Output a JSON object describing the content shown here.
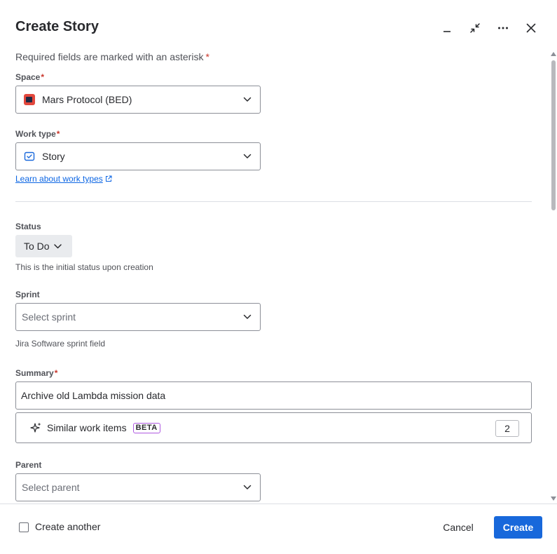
{
  "dialog": {
    "title": "Create Story",
    "required_note": "Required fields are marked with an asterisk",
    "asterisk": "*"
  },
  "header_actions": [
    "minimize-icon",
    "collapse-icon",
    "more-icon",
    "close-icon"
  ],
  "fields": {
    "space": {
      "label": "Space",
      "value": "Mars Protocol (BED)"
    },
    "work_type": {
      "label": "Work type",
      "value": "Story",
      "help_link": "Learn about work types"
    },
    "status": {
      "label": "Status",
      "value": "To Do",
      "help": "This is the initial status upon creation"
    },
    "sprint": {
      "label": "Sprint",
      "placeholder": "Select sprint",
      "help": "Jira Software sprint field"
    },
    "summary": {
      "label": "Summary",
      "value": "Archive old Lambda mission data"
    },
    "similar": {
      "label": "Similar work items",
      "badge": "BETA",
      "count": "2"
    },
    "parent": {
      "label": "Parent",
      "placeholder": "Select parent"
    }
  },
  "footer": {
    "create_another": "Create another",
    "cancel": "Cancel",
    "create": "Create"
  },
  "colors": {
    "primary": "#1868db",
    "asterisk": "#c9372c",
    "link": "#0c66e4",
    "beta_border": "#af59e1"
  }
}
